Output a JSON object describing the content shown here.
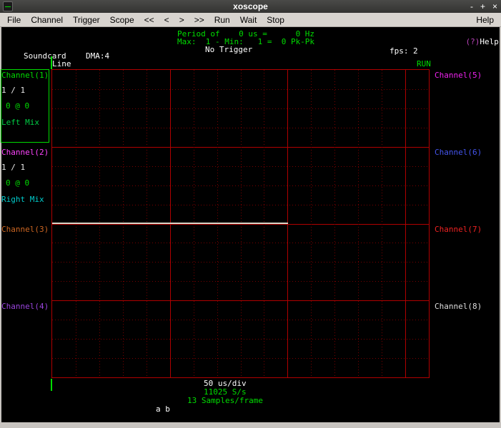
{
  "window": {
    "title": "xoscope",
    "controls": {
      "minimize": "-",
      "maximize": "+",
      "close": "×"
    }
  },
  "menu": {
    "items": [
      {
        "label": "File"
      },
      {
        "label": "Channel"
      },
      {
        "label": "Trigger"
      },
      {
        "label": "Scope"
      },
      {
        "label": "<<"
      },
      {
        "label": "<"
      },
      {
        "label": ">"
      },
      {
        "label": ">>"
      },
      {
        "label": "Run"
      },
      {
        "label": "Wait"
      },
      {
        "label": "Stop"
      }
    ],
    "help_label": "Help"
  },
  "status_top": {
    "period_line": "Period of    0 us =      0 Hz",
    "minmax_line": "Max:  1 - Min:   1 =  0 Pk-Pk",
    "trigger_line": "No Trigger",
    "help_glyph": "(?)",
    "help_text": "Help",
    "device": "Soundcard",
    "dma": "DMA:4",
    "fps_label": "fps:",
    "fps_value": "2",
    "graticule_label": "Line",
    "run_state": "RUN"
  },
  "channels_left": [
    {
      "label": "Channel(1)",
      "color": "#00dd00",
      "selected": true,
      "scale": "1 / 1",
      "scale_color": "#e8e8e8",
      "position": "0 @ 0",
      "position_color": "#00dd00",
      "source": "Left Mix",
      "source_color": "#00cc44"
    },
    {
      "label": "Channel(2)",
      "color": "#ff44ff",
      "scale": "1 / 1",
      "scale_color": "#e8e8e8",
      "position": "0 @ 0",
      "position_color": "#00dd00",
      "source": "Right Mix",
      "source_color": "#00cccc"
    },
    {
      "label": "Channel(3)",
      "color": "#cc6622"
    },
    {
      "label": "Channel(4)",
      "color": "#9944dd"
    }
  ],
  "channels_right": [
    {
      "label": "Channel(5)",
      "color": "#ee22ee"
    },
    {
      "label": "Channel(6)",
      "color": "#4455ee"
    },
    {
      "label": "Channel(7)",
      "color": "#ee2222"
    },
    {
      "label": "Channel(8)",
      "color": "#dddddd"
    }
  ],
  "status_bottom": {
    "timebase": "50 us/div",
    "sample_rate": "11025 S/s",
    "samples_per_frame": "13 Samples/frame",
    "cursor_keys": "a b"
  },
  "scope": {
    "trace_description": "flat line at center level, spanning left 2/3 of graticule"
  },
  "colors": {
    "green": "#00dd00",
    "grid_solid": "#b00000",
    "grid_dot": "#7a0000",
    "trace": "#d6d6c8",
    "help_glyph": "#bb44bb",
    "titlebar_bg": "#3d3d3b",
    "menubar_bg": "#d8d4cf"
  }
}
